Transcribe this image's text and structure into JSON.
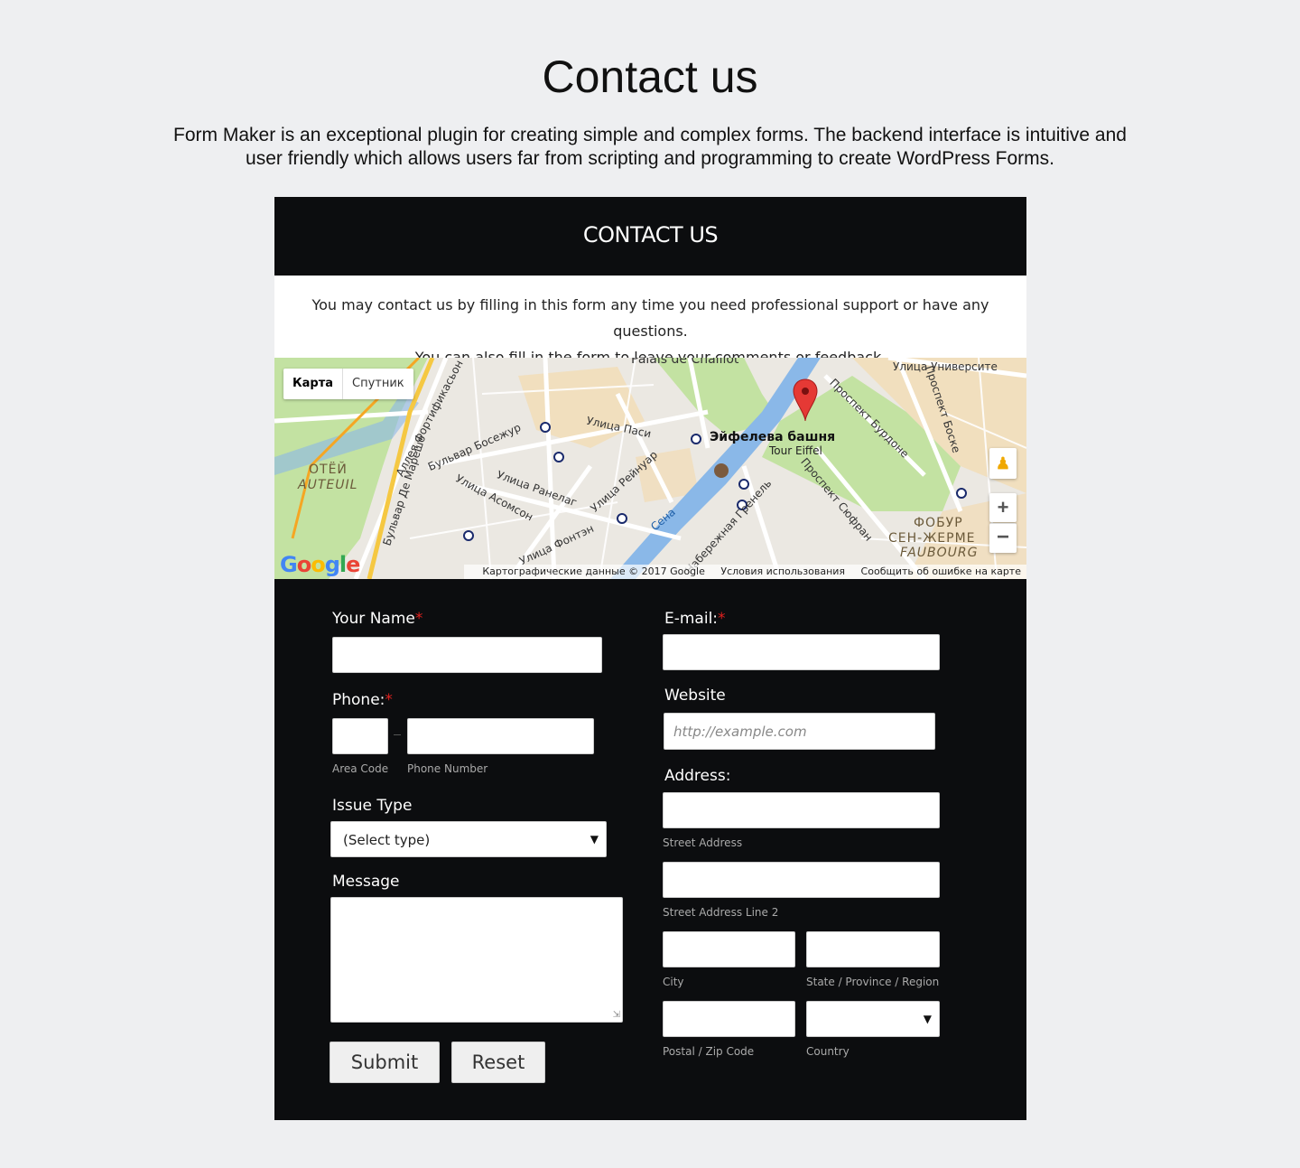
{
  "page": {
    "title": "Contact us",
    "description": "Form Maker is an exceptional plugin for creating simple and complex forms. The backend interface is intuitive and user friendly which allows users far from scripting and programming to create WordPress Forms."
  },
  "form": {
    "header": "CONTACT US",
    "intro_line1": "You may contact us by filling in this form any time you need professional support or have any questions.",
    "intro_line2": "You can also fill in the form to leave your comments or feedback."
  },
  "map": {
    "type_map": "Карта",
    "type_satellite": "Спутник",
    "zoom_in": "+",
    "zoom_out": "−",
    "marker_title": "Эйфелева башня",
    "marker_subtitle": "Tour Eiffel",
    "labels": {
      "palais": "Palais de Chaillot",
      "universite": "Улица Университе",
      "passy": "Улица Паси",
      "bosejour": "Бульвар Босежур",
      "ranelagh": "Улица Ранелаг",
      "reinouar": "Улица Рейнуар",
      "asomson": "Улица Асомсон",
      "seine": "Сена",
      "auteuil_ru": "ОТЁЙ",
      "auteuil": "AUTEUIL",
      "faubourg_ru1": "ФОБУР",
      "faubourg_ru2": "СЕН-ЖЕРМЕ",
      "faubourg": "FAUBOURG",
      "bourdonnais": "Проспект Бурдоне",
      "bosquet": "Проспект Боске",
      "suffren": "Проспект Сюфран",
      "grenelle": "Набережная Гренель",
      "fontaine": "Улица Фонтэн",
      "marechaux": "Бульвар Де Марешо",
      "fortif": "Аллея Фортификасьон"
    },
    "google": "Google",
    "attribution": "Картографические данные © 2017 Google",
    "terms": "Условия использования",
    "report": "Сообщить об ошибке на карте"
  },
  "fields": {
    "name_label": "Your Name",
    "email_label": "E-mail:",
    "phone_label": "Phone:",
    "area_code_hint": "Area Code",
    "phone_number_hint": "Phone Number",
    "website_label": "Website",
    "website_placeholder": "http://example.com",
    "issue_label": "Issue Type",
    "issue_selected": "(Select type)",
    "address_label": "Address:",
    "street_hint": "Street Address",
    "street2_hint": "Street Address Line 2",
    "city_hint": "City",
    "state_hint": "State / Province / Region",
    "zip_hint": "Postal / Zip Code",
    "country_hint": "Country",
    "message_label": "Message",
    "required_mark": "*"
  },
  "buttons": {
    "submit": "Submit",
    "reset": "Reset"
  },
  "colors": {
    "page_bg": "#eeeff1",
    "form_bg": "#0c0d0f",
    "required": "#e0201e",
    "marker": "#e53935",
    "water": "#8ab8e8",
    "park": "#c3e2a2"
  }
}
